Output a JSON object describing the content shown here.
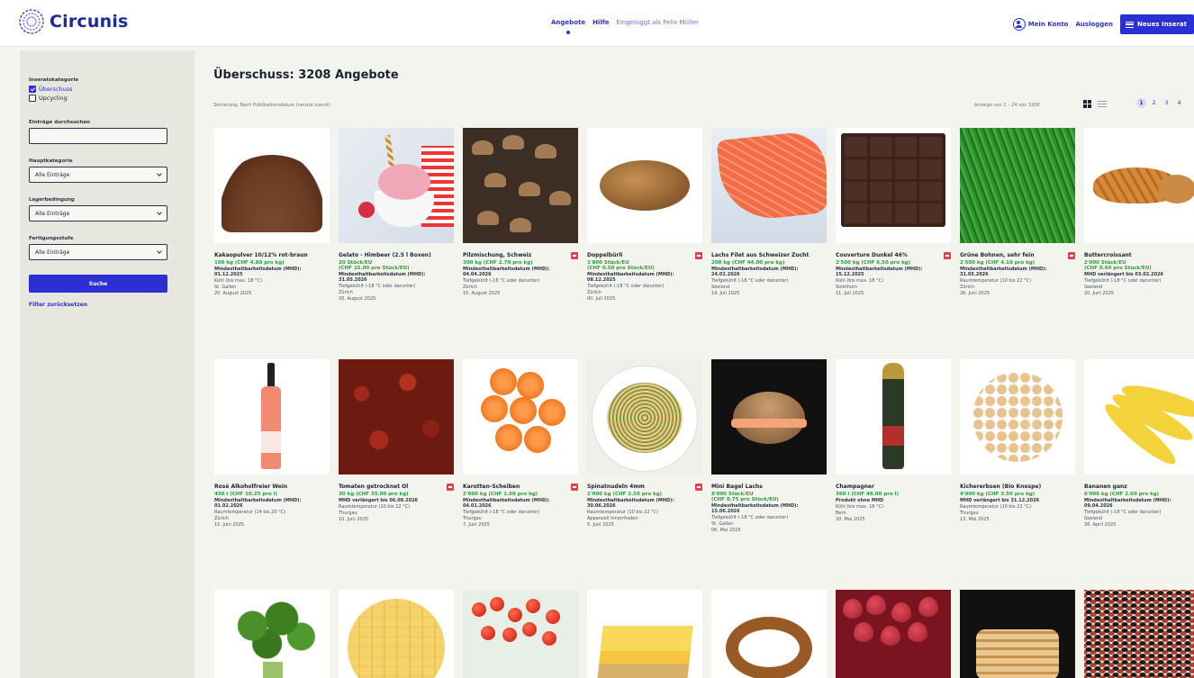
{
  "header": {
    "logo_text": "Circunis",
    "nav": [
      "Angebote",
      "Hilfe",
      "Eingeloggt als Felix Müller"
    ],
    "account_label": "Mein Konto",
    "logout_label": "Ausloggen",
    "new_offer_label": "Neues Inserat",
    "accent_color": "#2b2fd4"
  },
  "sidebar": {
    "category_label": "Inseratskategorie",
    "options": [
      {
        "label": "Überschuss",
        "checked": true
      },
      {
        "label": "Upcycling",
        "checked": false
      }
    ],
    "search_label": "Einträge durchsuchen",
    "search_value": "",
    "main_category_label": "Hauptkategorie",
    "main_category_value": "Alle Einträge",
    "storage_label": "Lagerbedingung",
    "storage_value": "Alle Einträge",
    "stage_label": "Fertigungsstufe",
    "stage_value": "Alle Einträge",
    "search_button": "Suche",
    "reset_link": "Filter zurücksetzen"
  },
  "main": {
    "title": "Überschuss: 3208 Angebote",
    "sorting": "Sortierung: Nach Publikationsdatum (neuste zuerst)",
    "showing": "Anzeige von 1 – 24 von 3208",
    "pages": [
      "1",
      "2",
      "3",
      "4"
    ]
  },
  "products": [
    {
      "name": "Kakaopulver 10/12% rot-braun",
      "price": "100 kg (CHF 4.80 pro kg)",
      "l1": "Mindesthaltbarkeitsdatum (MHD):",
      "l1b": "01.12.2025",
      "l2": "Kühl (bis max. 18 °C)",
      "l3": "St. Gallen",
      "l4": "20. August 2025",
      "flag": false
    },
    {
      "name": "Gelato - Himbeer (2.5 l Boxen)",
      "price": "20 Stück/EU",
      "price2": "(CHF 15.00 pro Stück/EU)",
      "l1": "Mindesthaltbarkeitsdatum (MHD):",
      "l1b": "31.05.2026",
      "l2": "Tiefgekühlt (-18 °C oder darunter)",
      "l3": "Zürich",
      "l4": "20. August 2025",
      "flag": false
    },
    {
      "name": "Pilzmischung, Schweiz",
      "price": "300 kg (CHF 2.70 pro kg)",
      "l1": "Mindesthaltbarkeitsdatum (MHD):",
      "l1b": "04.04.2026",
      "l2": "Tiefgekühlt (-18 °C oder darunter)",
      "l3": "Zürich",
      "l4": "15. August 2025",
      "flag": true
    },
    {
      "name": "Doppelbürli",
      "price": "1'800 Stück/EU",
      "price2": "(CHF 0.50 pro Stück/EU)",
      "l1": "Mindesthaltbarkeitsdatum (MHD):",
      "l1b": "08.12.2025",
      "l2": "Tiefgekühlt (-18 °C oder darunter)",
      "l3": "Zürich",
      "l4": "00. Juli 2025",
      "flag": true
    },
    {
      "name": "Lachs Filet aus Schweizer Zucht",
      "price": "200 kg (CHF 44.00 pro kg)",
      "l1": "Mindesthaltbarkeitsdatum (MHD):",
      "l1b": "24.02.2026",
      "l2": "Tiefgekühlt (-18 °C oder darunter)",
      "l3": "Seeland",
      "l4": "14. Juli 2025",
      "flag": false
    },
    {
      "name": "Couverture Dunkel 46%",
      "price": "2'500 kg (CHF 6.50 pro kg)",
      "l1": "Mindesthaltbarkeitsdatum (MHD):",
      "l1b": "15.12.2025",
      "l2": "Kühl (bis max. 18 °C)",
      "l3": "Solothurn",
      "l4": "11. Juli 2025",
      "flag": true
    },
    {
      "name": "Grüne Bohnen, sehr fein",
      "price": "2'500 kg (CHF 4.10 pro kg)",
      "l1": "Mindesthaltbarkeitsdatum (MHD):",
      "l1b": "31.05.2026",
      "l2": "Raumtemperatur (10 bis 22 °C)",
      "l3": "Zürich",
      "l4": "26. Juni 2025",
      "flag": true
    },
    {
      "name": "Buttercroissant",
      "price": "2'000 Stück/EU",
      "price2": "(CHF 0.60 pro Stück/EU)",
      "l1": "MHD verlängert bis 03.02.2026",
      "l1b": "",
      "l2": "Tiefgekühlt (-18 °C oder darunter)",
      "l3": "Seeland",
      "l4": "20. Juni 2025",
      "flag": false
    },
    {
      "name": "Rosé Alkoholfreier Wein",
      "price": "450 l (CHF 10.25 pro l)",
      "l1": "Mindesthaltbarkeitsdatum (MHD):",
      "l1b": "01.02.2026",
      "l2": "Raumtemperatur (14 bis 20 °C)",
      "l3": "Zürich",
      "l4": "15. Juni 2025",
      "flag": false
    },
    {
      "name": "Tomaten getrocknet Öl",
      "price": "30 kg (CHF 35.00 pro kg)",
      "l1": "MHD verlängert bis 06.08.2026",
      "l1b": "",
      "l2": "Raumtemperatur (10 bis 22 °C)",
      "l3": "Thurgau",
      "l4": "10. Juni 2025",
      "flag": true
    },
    {
      "name": "Karotten-Scheiben",
      "price": "2'000 kg (CHF 1.00 pro kg)",
      "l1": "Mindesthaltbarkeitsdatum (MHD):",
      "l1b": "04.01.2026",
      "l2": "Tiefgekühlt (-18 °C oder darunter)",
      "l3": "Thurgau",
      "l4": "7. Juni 2025",
      "flag": true
    },
    {
      "name": "Spinatnudeln 4mm",
      "price": "2'000 kg (CHF 2.50 pro kg)",
      "l1": "Mindesthaltbarkeitsdatum (MHD):",
      "l1b": "30.06.2026",
      "l2": "Raumtemperatur (10 bis 22 °C)",
      "l3": "Appenzell Innerrhoden",
      "l4": "5. Juni 2025",
      "flag": true
    },
    {
      "name": "Mini Bagel Lachs",
      "price": "8'000 Stück/EU",
      "price2": "(CHF 0.75 pro Stück/EU)",
      "l1": "Mindesthaltbarkeitsdatum (MHD):",
      "l1b": "15.06.2026",
      "l2": "Tiefgekühlt (-18 °C oder darunter)",
      "l3": "St. Gallen",
      "l4": "06. Mai 2025",
      "flag": false
    },
    {
      "name": "Champagner",
      "price": "360 l (CHF 48.00 pro l)",
      "l1": "Produkt ohne MHD",
      "l1b": "",
      "l2": "Kühl (bis max. 18 °C)",
      "l3": "Bern",
      "l4": "20. Mai 2025",
      "flag": false
    },
    {
      "name": "Kichererbsen (Bio Knospe)",
      "price": "4'000 kg (CHF 3.50 pro kg)",
      "l1": "MHD verlängert bis 31.12.2026",
      "l1b": "",
      "l2": "Raumtemperatur (10 bis 22 °C)",
      "l3": "Thurgau",
      "l4": "13. Mai 2025",
      "flag": false
    },
    {
      "name": "Bananen ganz",
      "price": "6'000 kg (CHF 2.60 pro kg)",
      "l1": "Mindesthaltbarkeitsdatum (MHD):",
      "l1b": "09.04.2026",
      "l2": "Tiefgekühlt (-18 °C oder darunter)",
      "l3": "Seeland",
      "l4": "26. April 2025",
      "flag": false
    }
  ]
}
